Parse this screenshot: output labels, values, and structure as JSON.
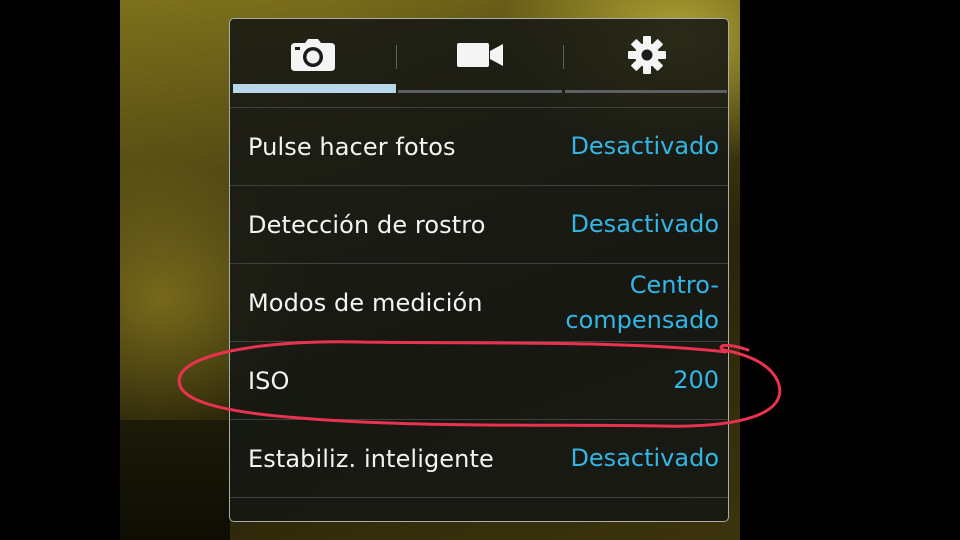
{
  "tabs": [
    {
      "icon": "camera-icon",
      "active": true
    },
    {
      "icon": "video-camera-icon",
      "active": false
    },
    {
      "icon": "gear-icon",
      "active": false
    }
  ],
  "settings": [
    {
      "label": "Pulse hacer fotos",
      "value": "Desactivado"
    },
    {
      "label": "Detección de rostro",
      "value": "Desactivado"
    },
    {
      "label": "Modos de medición",
      "value": "Centro-compensado"
    },
    {
      "label": "ISO",
      "value": "200"
    },
    {
      "label": "Estabiliz. inteligente",
      "value": "Desactivado"
    }
  ],
  "colors": {
    "accent": "#33b5e5",
    "active_tab_bar": "#b8d7ea",
    "annotation": "#e8324f"
  }
}
